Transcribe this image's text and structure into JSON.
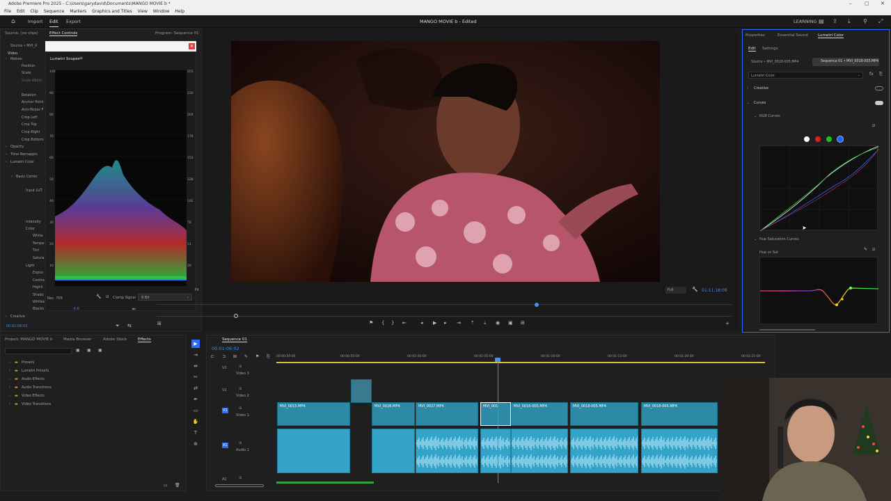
{
  "window": {
    "title": "Adobe Premiere Pro 2025 - C:\\Users\\garydavid\\Documents\\MANGO MOVIE b *"
  },
  "menu": [
    "File",
    "Edit",
    "Clip",
    "Sequence",
    "Markers",
    "Graphics and Titles",
    "View",
    "Window",
    "Help"
  ],
  "workspace": {
    "tabs": [
      "Import",
      "Edit",
      "Export"
    ],
    "project_title": "MANGO MOVIE b - Edited",
    "learning": "LEARNING"
  },
  "left_panel": {
    "tabs": [
      "Source: (no clips)",
      "Effect Controls",
      "Program: Sequence 01"
    ],
    "source_label": "Source • MVI_0",
    "section_video": "Video",
    "effects": [
      "Motion",
      "Position",
      "Scale",
      "Scale Width",
      "Rotation",
      "Anchor Point",
      "Anti-flicker F",
      "Crop Left",
      "Crop Top",
      "Crop Right",
      "Crop Bottom",
      "Opacity",
      "Time Remappin",
      "Lumetri Color",
      "Basic Correc",
      "Input LUT",
      "Intensity",
      "Color",
      "White",
      "Tempe",
      "Tint",
      "Satura",
      "Light",
      "Expos",
      "Contra",
      "Highli",
      "Shado",
      "Whites",
      "Blacks",
      "Creative"
    ],
    "timecode": "00:01:06:02"
  },
  "scopes": {
    "title": "Lumetri Scopes",
    "left_axis": [
      "100",
      "90",
      "80",
      "70",
      "60",
      "50",
      "40",
      "30",
      "20",
      "10"
    ],
    "right_axis": [
      "255",
      "230",
      "204",
      "178",
      "153",
      "128",
      "102",
      "76",
      "51",
      "26"
    ],
    "footer_label": "Rec. 709",
    "clamp_label": "Clamp Signal",
    "bit_depth": "8 Bit",
    "footer_value": "-0.6",
    "fit_label": "Fit"
  },
  "program": {
    "zoom": "Full",
    "timecode": "01:11:18:09"
  },
  "lumetri": {
    "tabs": [
      "Properties",
      "Essential Sound",
      "Lumetri Color"
    ],
    "subtabs": [
      "Edit",
      "Settings"
    ],
    "source_clip": "Source • MVI_0018-005.MP4",
    "sequence_clip": "Sequence 01 • MVI_0018-005.MP4",
    "effect_select": "Lumetri Color",
    "creative": "Creative",
    "curves": "Curves",
    "rgb_curves": "RGB Curves",
    "hue_sat": "Hue Saturation Curves",
    "hue_vs_sat": "Hue vs Sat",
    "channel_colors": [
      "#ffffff",
      "#e02020",
      "#20c020",
      "#2060ff"
    ]
  },
  "project": {
    "tabs": [
      "Project: MANGO MOVIE b",
      "Media Browser",
      "Adobe Stock",
      "Effects"
    ],
    "items": [
      "Presets",
      "Lumetri Presets",
      "Audio Effects",
      "Audio Transitions",
      "Video Effects",
      "Video Transitions"
    ]
  },
  "timeline": {
    "tab": "Sequence 01",
    "timecode": "00:01:06:02",
    "ruler": [
      "00:00:50:00",
      "00:00:55:00",
      "00:01:00:00",
      "00:01:05:00",
      "00:01:10:00",
      "00:01:15:00",
      "00:01:20:00",
      "00:01:25:00"
    ],
    "tracks": [
      {
        "id": "V3",
        "name": "Video 3"
      },
      {
        "id": "V2",
        "name": "Video 2"
      },
      {
        "id": "V1",
        "name": "Video 1"
      },
      {
        "id": "A1",
        "name": "Audio 1"
      },
      {
        "id": "A2",
        "name": ""
      }
    ],
    "clips": [
      "MVI_0015.MP4",
      "MVI_0026.MP4",
      "MVI_0027.MP4",
      "MVI_001",
      "MVI_0016-005.MP4",
      "MVI_0018-005.MP4",
      "MVI_0018-005.MP4"
    ]
  }
}
